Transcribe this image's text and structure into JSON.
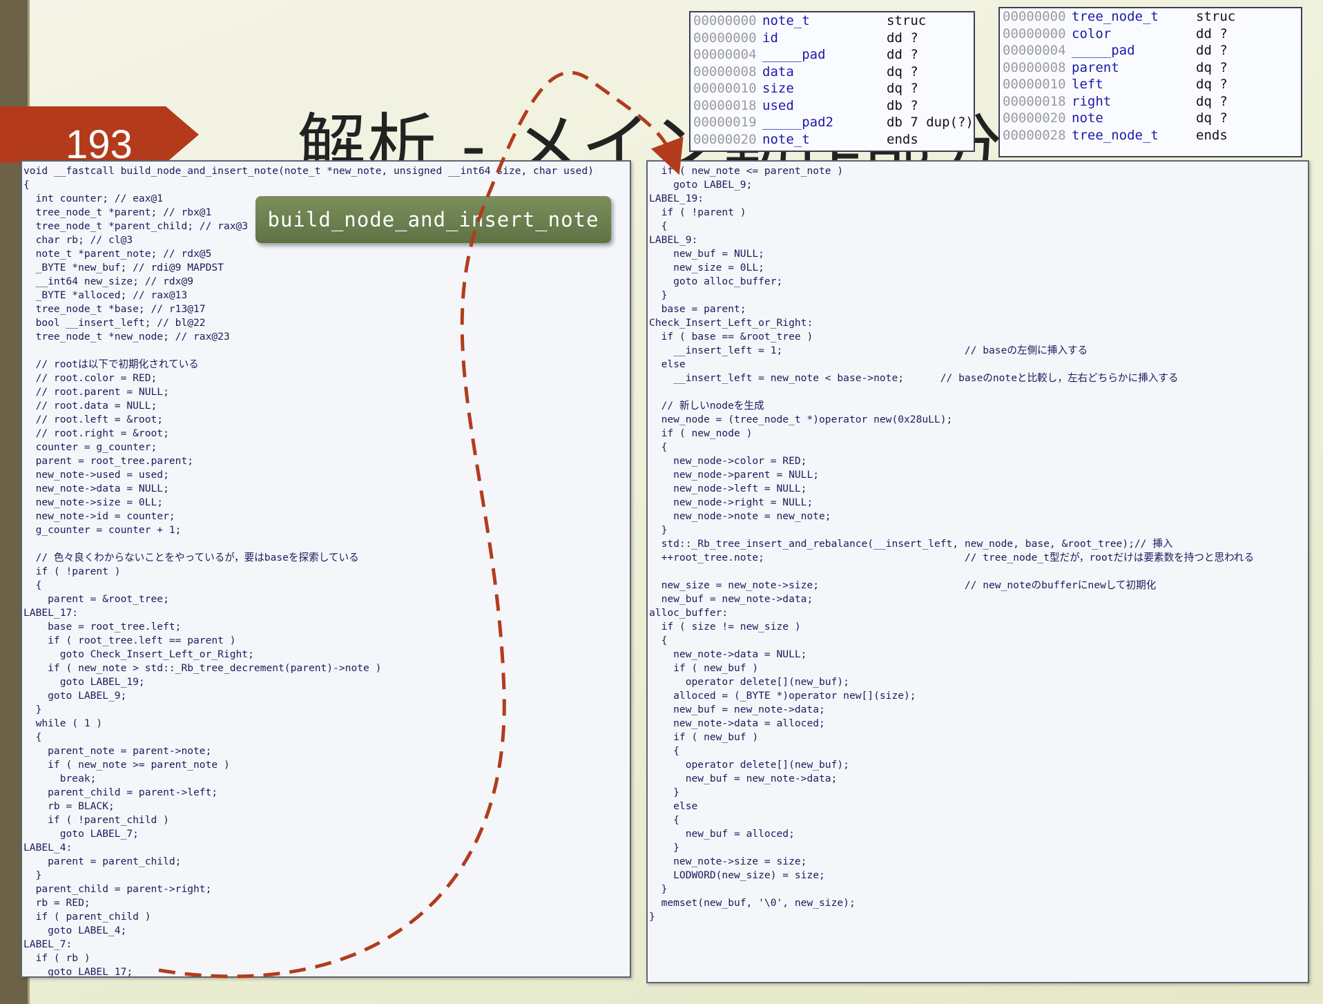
{
  "slide": {
    "number": "193",
    "title": "解析 - メイン動作部分"
  },
  "callout": {
    "label": "build_node_and_insert_note"
  },
  "struct_note": [
    {
      "offset": "00000000",
      "name": "note_t",
      "type": "struc"
    },
    {
      "offset": "00000000",
      "name": "id",
      "type": "dd ?"
    },
    {
      "offset": "00000004",
      "name": "_____pad",
      "type": "dd ?"
    },
    {
      "offset": "00000008",
      "name": "data",
      "type": "dq ?"
    },
    {
      "offset": "00000010",
      "name": "size",
      "type": "dq ?"
    },
    {
      "offset": "00000018",
      "name": "used",
      "type": "db ?"
    },
    {
      "offset": "00000019",
      "name": "_____pad2",
      "type": "db 7 dup(?)"
    },
    {
      "offset": "00000020",
      "name": "note_t",
      "type": "ends"
    }
  ],
  "struct_tree": [
    {
      "offset": "00000000",
      "name": "tree_node_t",
      "type": "struc"
    },
    {
      "offset": "00000000",
      "name": "color",
      "type": "dd ?"
    },
    {
      "offset": "00000004",
      "name": "_____pad",
      "type": "dd ?"
    },
    {
      "offset": "00000008",
      "name": "parent",
      "type": "dq ?"
    },
    {
      "offset": "00000010",
      "name": "left",
      "type": "dq ?"
    },
    {
      "offset": "00000018",
      "name": "right",
      "type": "dq ?"
    },
    {
      "offset": "00000020",
      "name": "note",
      "type": "dq ?"
    },
    {
      "offset": "00000028",
      "name": "tree_node_t",
      "type": "ends"
    }
  ],
  "left_code": [
    "void __fastcall build_node_and_insert_note(note_t *new_note, unsigned __int64 size, char used)",
    "{",
    "  int counter; // eax@1",
    "  tree_node_t *parent; // rbx@1",
    "  tree_node_t *parent_child; // rax@3",
    "  char rb; // cl@3",
    "  note_t *parent_note; // rdx@5",
    "  _BYTE *new_buf; // rdi@9 MAPDST",
    "  __int64 new_size; // rdx@9",
    "  _BYTE *alloced; // rax@13",
    "  tree_node_t *base; // r13@17",
    "  bool __insert_left; // bl@22",
    "  tree_node_t *new_node; // rax@23",
    "",
    "  // rootは以下で初期化されている",
    "  // root.color = RED;",
    "  // root.parent = NULL;",
    "  // root.data = NULL;",
    "  // root.left = &root;",
    "  // root.right = &root;",
    "  counter = g_counter;",
    "  parent = root_tree.parent;",
    "  new_note->used = used;",
    "  new_note->data = NULL;",
    "  new_note->size = 0LL;",
    "  new_note->id = counter;",
    "  g_counter = counter + 1;",
    "",
    "  // 色々良くわからないことをやっているが，要はbaseを探索している",
    "  if ( !parent )",
    "  {",
    "    parent = &root_tree;",
    "LABEL_17:",
    "    base = root_tree.left;",
    "    if ( root_tree.left == parent )",
    "      goto Check_Insert_Left_or_Right;",
    "    if ( new_note > std::_Rb_tree_decrement(parent)->note )",
    "      goto LABEL_19;",
    "    goto LABEL_9;",
    "  }",
    "  while ( 1 )",
    "  {",
    "    parent_note = parent->note;",
    "    if ( new_note >= parent_note )",
    "      break;",
    "    parent_child = parent->left;",
    "    rb = BLACK;",
    "    if ( !parent_child )",
    "      goto LABEL_7;",
    "LABEL_4:",
    "    parent = parent_child;",
    "  }",
    "  parent_child = parent->right;",
    "  rb = RED;",
    "  if ( parent_child )",
    "    goto LABEL_4;",
    "LABEL_7:",
    "  if ( rb )",
    "    goto LABEL_17;"
  ],
  "right_code": [
    "  if ( new_note <= parent_note )",
    "    goto LABEL_9;",
    "LABEL_19:",
    "  if ( !parent )",
    "  {",
    "LABEL_9:",
    "    new_buf = NULL;",
    "    new_size = 0LL;",
    "    goto alloc_buffer;",
    "  }",
    "  base = parent;",
    "Check_Insert_Left_or_Right:",
    "  if ( base == &root_tree )",
    "    __insert_left = 1;                              // baseの左側に挿入する",
    "  else",
    "    __insert_left = new_note < base->note;      // baseのnoteと比較し，左右どちらかに挿入する",
    "",
    "  // 新しいnodeを生成",
    "  new_node = (tree_node_t *)operator new(0x28uLL);",
    "  if ( new_node )",
    "  {",
    "    new_node->color = RED;",
    "    new_node->parent = NULL;",
    "    new_node->left = NULL;",
    "    new_node->right = NULL;",
    "    new_node->note = new_note;",
    "  }",
    "  std::_Rb_tree_insert_and_rebalance(__insert_left, new_node, base, &root_tree);// 挿入",
    "  ++root_tree.note;                                 // tree_node_t型だが，rootだけは要素数を持つと思われる",
    "",
    "  new_size = new_note->size;                        // new_noteのbufferにnewして初期化",
    "  new_buf = new_note->data;",
    "alloc_buffer:",
    "  if ( size != new_size )",
    "  {",
    "    new_note->data = NULL;",
    "    if ( new_buf )",
    "      operator delete[](new_buf);",
    "    alloced = (_BYTE *)operator new[](size);",
    "    new_buf = new_note->data;",
    "    new_note->data = alloced;",
    "    if ( new_buf )",
    "    {",
    "      operator delete[](new_buf);",
    "      new_buf = new_note->data;",
    "    }",
    "    else",
    "    {",
    "      new_buf = alloced;",
    "    }",
    "    new_note->size = size;",
    "    LODWORD(new_size) = size;",
    "  }",
    "  memset(new_buf, '\\0', new_size);",
    "}"
  ],
  "colors": {
    "banner": "#b33b1c",
    "callout": "#6b7e4e",
    "arrow": "#b33b1c",
    "keyword_var": "#8c92c4",
    "comment": "#2d8a2d"
  }
}
